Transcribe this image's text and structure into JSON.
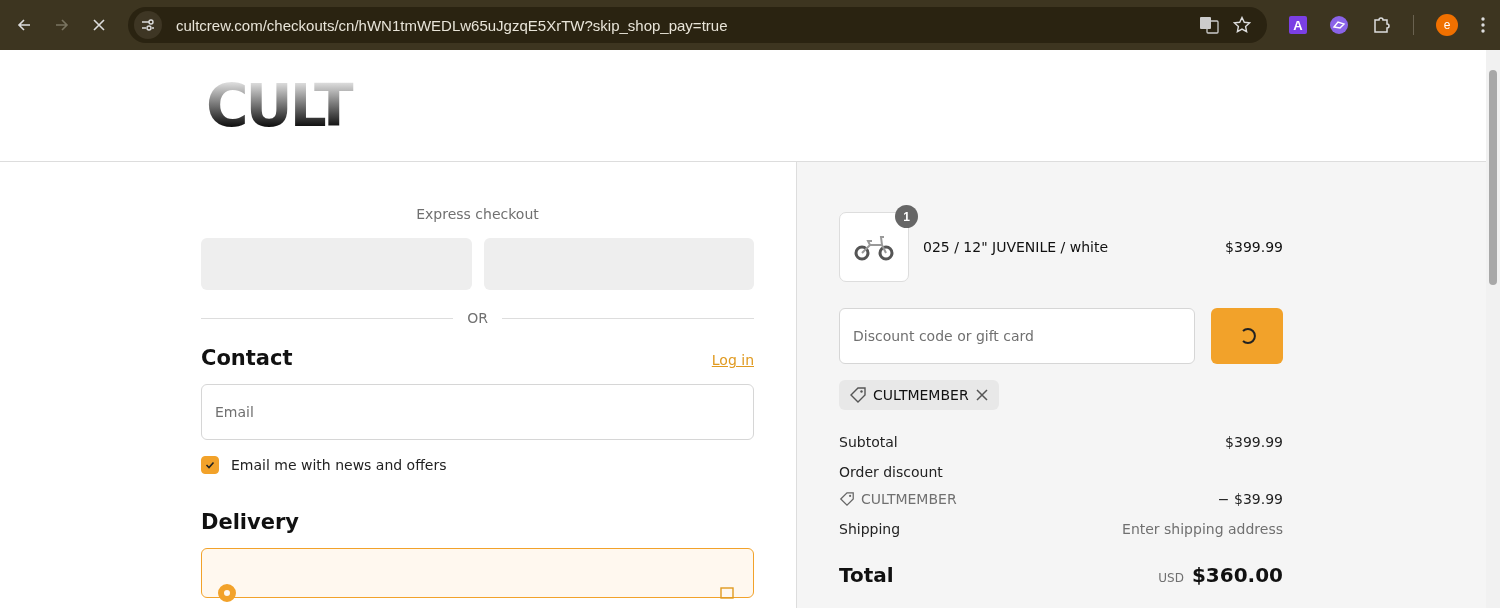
{
  "browser": {
    "url": "cultcrew.com/checkouts/cn/hWN1tmWEDLw65uJgzqE5XrTW?skip_shop_pay=true",
    "extension_letter": "A",
    "profile_letter": "e",
    "loading": true
  },
  "logo": "CULT",
  "express": {
    "title": "Express checkout",
    "divider": "OR"
  },
  "contact": {
    "title": "Contact",
    "login": "Log in",
    "email_placeholder": "Email",
    "newsletter": {
      "label": "Email me with news and offers",
      "checked": true
    }
  },
  "delivery": {
    "title": "Delivery",
    "options": [
      {
        "selected": true
      }
    ]
  },
  "summary": {
    "items": [
      {
        "quantity": "1",
        "title": "025 / 12\" JUVENILE / white",
        "price": "$399.99"
      }
    ],
    "discount_placeholder": "Discount code or gift card",
    "applied_codes": [
      "CULTMEMBER"
    ],
    "lines": [
      {
        "kind": "plain",
        "label": "Subtotal",
        "value": "$399.99"
      },
      {
        "kind": "heading",
        "label": "Order discount"
      },
      {
        "kind": "code",
        "label": "CULTMEMBER",
        "value": "− $39.99"
      },
      {
        "kind": "muted",
        "label": "Shipping",
        "value": "Enter shipping address"
      }
    ],
    "total": {
      "label": "Total",
      "currency": "USD",
      "amount": "$360.00"
    }
  }
}
